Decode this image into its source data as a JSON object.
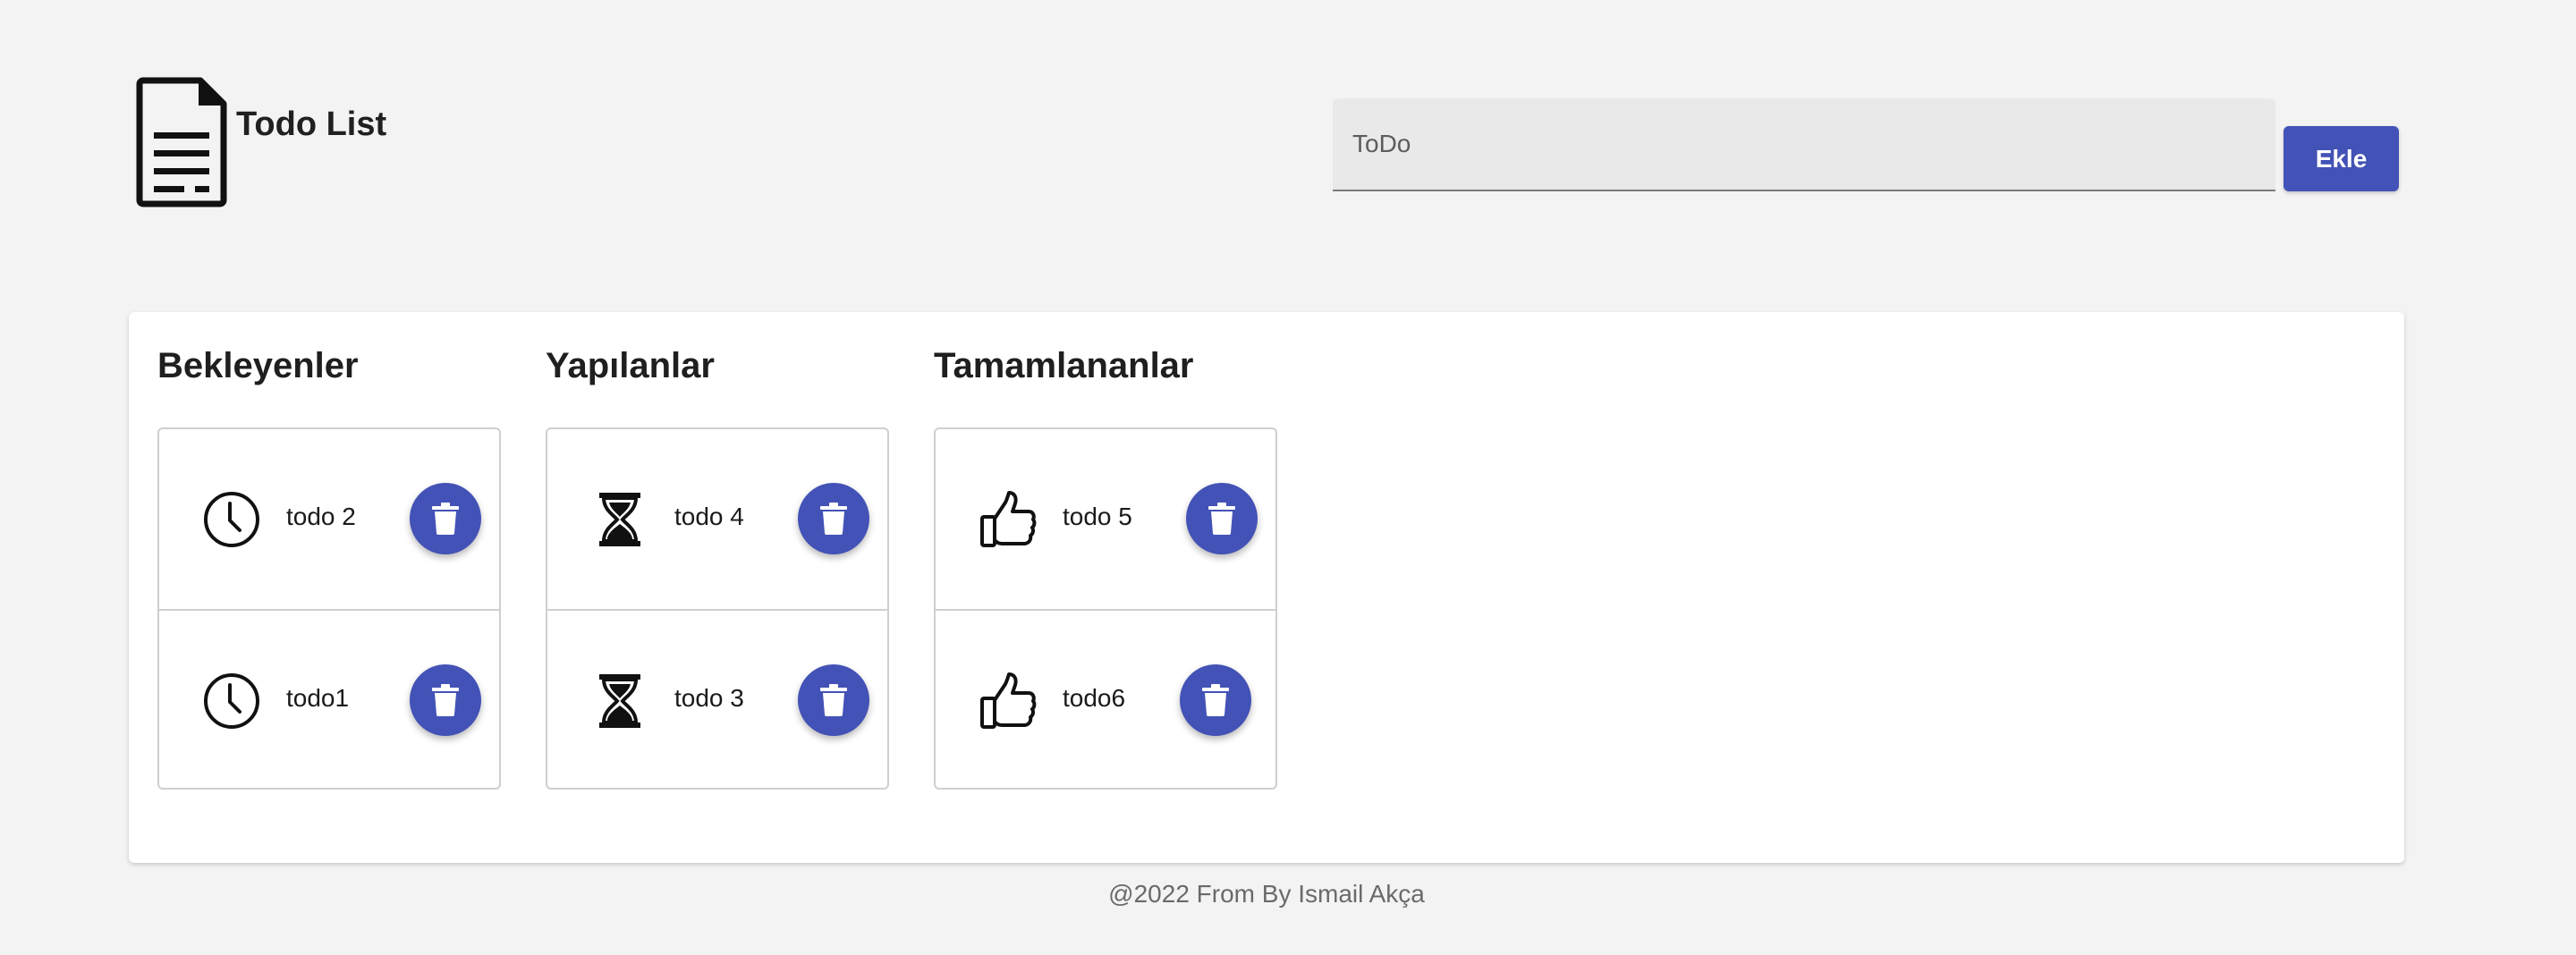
{
  "header": {
    "title": "Todo List",
    "logo_icon": "document-icon"
  },
  "form": {
    "placeholder": "ToDo",
    "value": "",
    "add_label": "Ekle"
  },
  "colors": {
    "accent": "#4352b6",
    "background": "#f3f3f3",
    "card": "#ffffff"
  },
  "columns": [
    {
      "title": "Bekleyenler",
      "icon": "clock-icon",
      "items": [
        {
          "label": "todo 2"
        },
        {
          "label": "todo1"
        }
      ]
    },
    {
      "title": "Yapılanlar",
      "icon": "hourglass-icon",
      "items": [
        {
          "label": "todo 4"
        },
        {
          "label": "todo 3"
        }
      ]
    },
    {
      "title": "Tamamlananlar",
      "icon": "thumbs-up-icon",
      "items": [
        {
          "label": "todo 5"
        },
        {
          "label": "todo6"
        }
      ]
    }
  ],
  "footer": {
    "text": "@2022 From By Ismail Akça"
  }
}
